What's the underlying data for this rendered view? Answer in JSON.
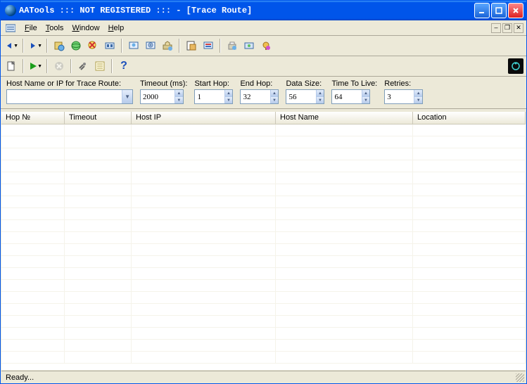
{
  "window": {
    "title": "AATools ::: NOT REGISTERED ::: - [Trace Route]"
  },
  "menu": {
    "file": "File",
    "tools": "Tools",
    "window": "Window",
    "help": "Help"
  },
  "inputs": {
    "host_label": "Host Name or IP for Trace Route:",
    "host_value": "",
    "timeout_label": "Timeout (ms):",
    "timeout_value": "2000",
    "starthop_label": "Start Hop:",
    "starthop_value": "1",
    "endhop_label": "End Hop:",
    "endhop_value": "32",
    "datasize_label": "Data Size:",
    "datasize_value": "56",
    "ttl_label": "Time To Live:",
    "ttl_value": "64",
    "retries_label": "Retries:",
    "retries_value": "3"
  },
  "columns": [
    "Hop №",
    "Timeout",
    "Host IP",
    "Host Name",
    "Location"
  ],
  "status": "Ready..."
}
